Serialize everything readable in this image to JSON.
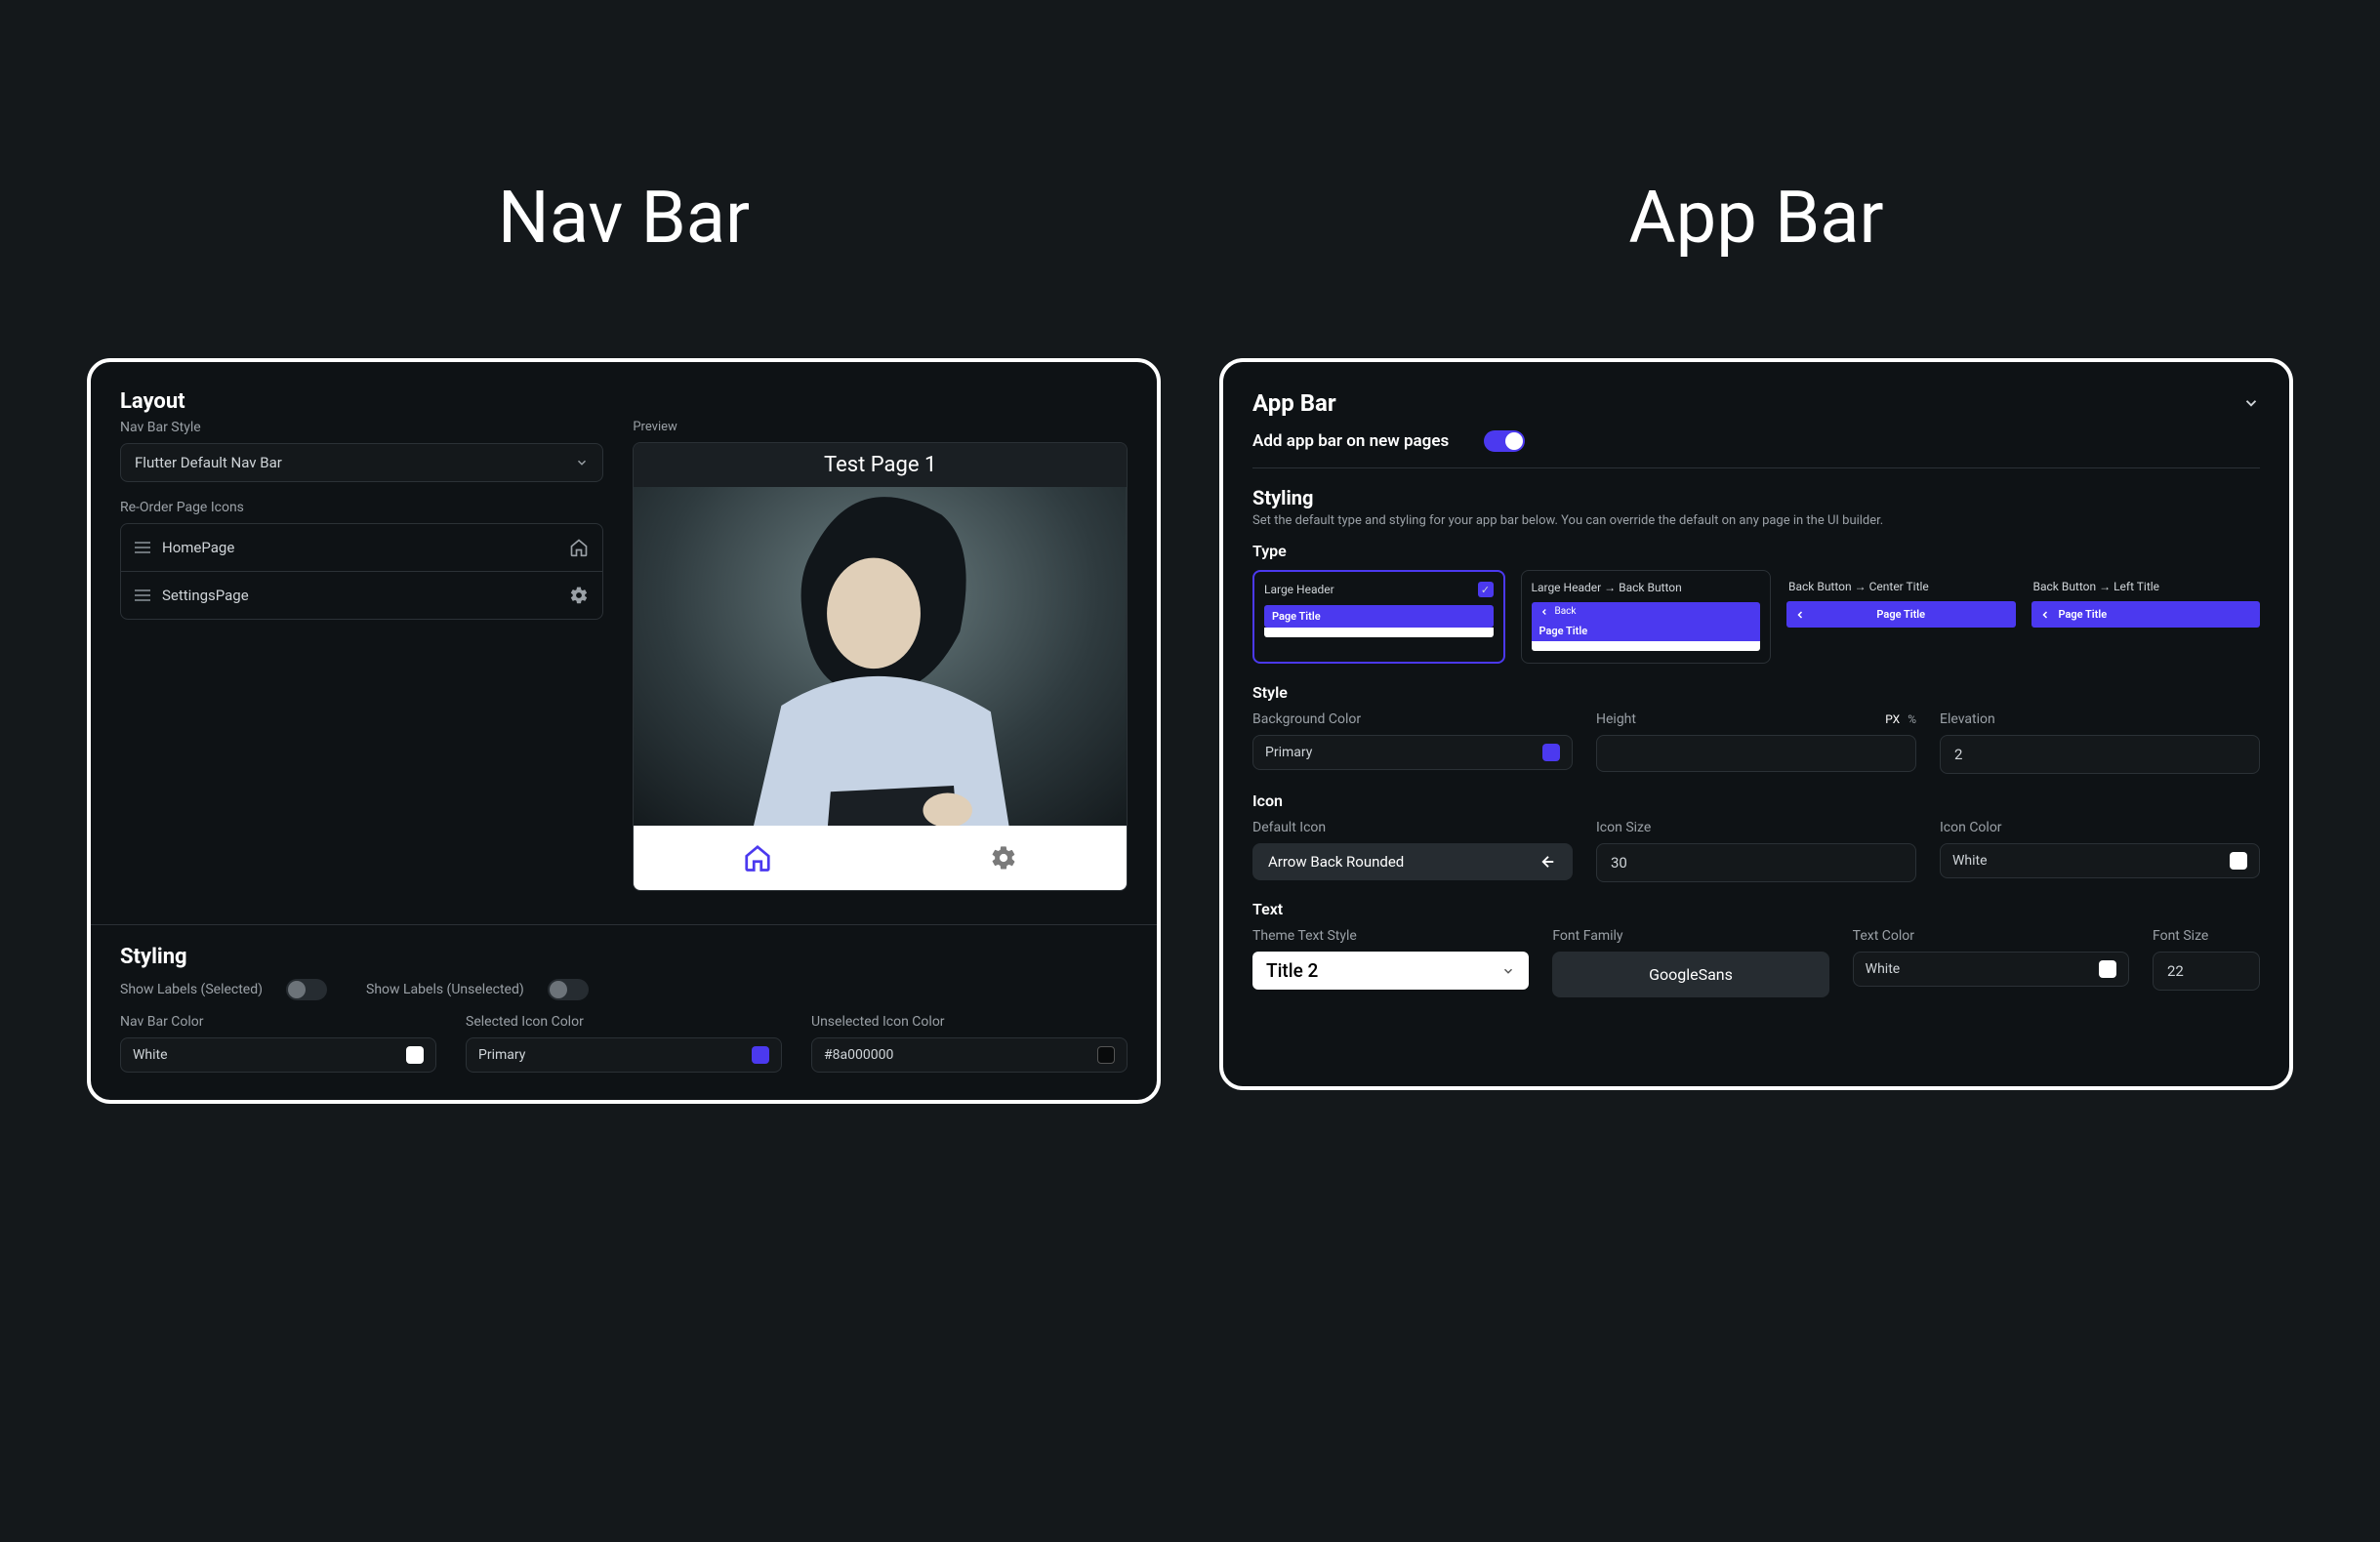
{
  "headings": {
    "nav_bar": "Nav Bar",
    "app_bar": "App Bar"
  },
  "colors": {
    "primary": "#4b39ef",
    "white": "#ffffff",
    "unselected_hex": "#8a000000"
  },
  "navbar_panel": {
    "layout_title": "Layout",
    "nav_bar_style_label": "Nav Bar Style",
    "nav_bar_style_value": "Flutter Default Nav Bar",
    "reorder_label": "Re-Order Page Icons",
    "pages": [
      {
        "name": "HomePage",
        "icon": "home"
      },
      {
        "name": "SettingsPage",
        "icon": "gear"
      }
    ],
    "preview_label": "Preview",
    "preview_title": "Test Page 1",
    "styling_title": "Styling",
    "show_labels_selected_label": "Show Labels (Selected)",
    "show_labels_selected_on": false,
    "show_labels_unselected_label": "Show Labels (Unselected)",
    "show_labels_unselected_on": false,
    "nav_bar_color_label": "Nav Bar Color",
    "nav_bar_color_value": "White",
    "selected_icon_color_label": "Selected Icon Color",
    "selected_icon_color_value": "Primary",
    "unselected_icon_color_label": "Unselected Icon Color",
    "unselected_icon_color_value": "#8a000000"
  },
  "appbar_panel": {
    "title": "App Bar",
    "add_on_new_pages_label": "Add app bar on new pages",
    "add_on_new_pages_on": true,
    "styling_title": "Styling",
    "styling_desc": "Set the default type and styling for your app bar below. You can override the default on any page in the UI builder.",
    "type_label": "Type",
    "type_options": [
      {
        "label": "Large Header",
        "selected": true,
        "variant": "large"
      },
      {
        "label": "Large Header → Back Button",
        "selected": false,
        "variant": "large_back"
      },
      {
        "label": "Back Button → Center Title",
        "selected": false,
        "variant": "center"
      },
      {
        "label": "Back Button → Left Title",
        "selected": false,
        "variant": "left"
      }
    ],
    "mini": {
      "page_title": "Page Title",
      "back": "Back"
    },
    "style_label": "Style",
    "background_color_label": "Background Color",
    "background_color_value": "Primary",
    "height_label": "Height",
    "height_unit_px": "PX",
    "height_unit_pct": "%",
    "height_value": "",
    "elevation_label": "Elevation",
    "elevation_value": "2",
    "icon_label": "Icon",
    "default_icon_label": "Default Icon",
    "default_icon_value": "Arrow Back Rounded",
    "icon_size_label": "Icon Size",
    "icon_size_value": "30",
    "icon_color_label": "Icon Color",
    "icon_color_value": "White",
    "text_label": "Text",
    "theme_text_style_label": "Theme Text Style",
    "theme_text_style_value": "Title 2",
    "font_family_label": "Font Family",
    "font_family_value": "GoogleSans",
    "text_color_label": "Text Color",
    "text_color_value": "White",
    "font_size_label": "Font Size",
    "font_size_value": "22"
  }
}
